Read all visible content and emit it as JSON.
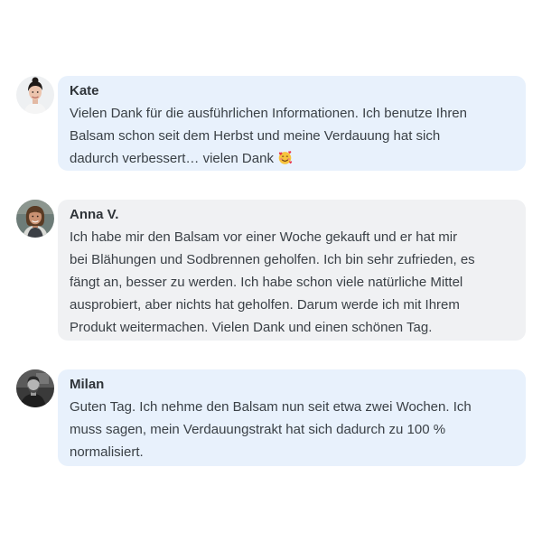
{
  "comments": [
    {
      "author": "Kate",
      "bubble_color": "#e8f1fc",
      "avatar_icon": "woman-portrait-avatar",
      "lines": [
        "Vielen Dank für die ausführlichen Informationen. Ich benutze Ihren",
        "Balsam schon seit dem Herbst und meine Verdauung hat sich",
        "dadurch verbessert… vielen Dank"
      ],
      "emoji": "smiling-face-with-hearts-icon"
    },
    {
      "author": "Anna V.",
      "bubble_color": "#f0f1f3",
      "avatar_icon": "woman-portrait-avatar",
      "lines": [
        "Ich habe mir den Balsam vor einer Woche gekauft und er hat mir",
        "bei Blähungen und Sodbrennen geholfen. Ich bin sehr zufrieden, es",
        "fängt an, besser zu werden. Ich habe schon viele natürliche Mittel",
        "ausprobiert, aber nichts hat geholfen. Darum werde ich mit Ihrem",
        "Produkt weitermachen. Vielen Dank und einen schönen Tag."
      ]
    },
    {
      "author": "Milan",
      "bubble_color": "#e8f1fc",
      "avatar_icon": "man-grayscale-avatar",
      "lines": [
        "Guten Tag. Ich nehme den Balsam nun seit etwa zwei Wochen. Ich",
        "muss sagen, mein Verdauungstrakt hat sich dadurch zu 100 %",
        "normalisiert."
      ]
    }
  ]
}
